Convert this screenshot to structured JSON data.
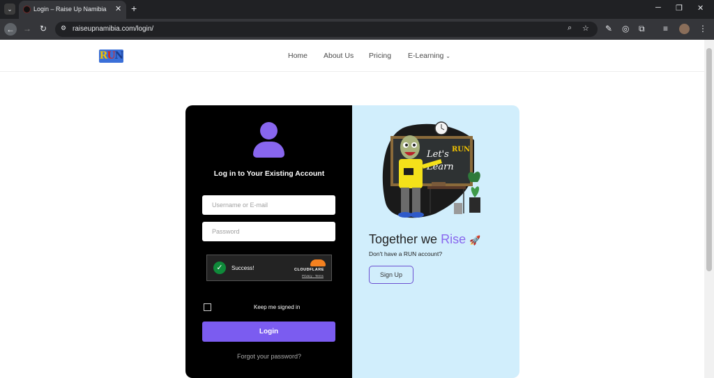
{
  "browser": {
    "tab_title": "Login – Raise Up Namibia",
    "url": "raiseupnamibia.com/login/"
  },
  "site": {
    "logo": {
      "r": "R",
      "u": "U",
      "n": "N"
    },
    "menu": [
      "Home",
      "About Us",
      "Pricing",
      "E-Learning"
    ]
  },
  "login": {
    "heading": "Log in to Your Existing Account",
    "username_placeholder": "Username or E-mail",
    "password_placeholder": "Password",
    "captcha_status": "Success!",
    "captcha_brand": "CLOUDFLARE",
    "captcha_privacy": "Privacy",
    "captcha_terms": "Terms",
    "keep_signed_in": "Keep me signed in",
    "login_button": "Login",
    "forgot_password": "Forgot your password?"
  },
  "promo": {
    "illustration_text_1": "Let's",
    "illustration_text_2": "Learn",
    "illustration_text_3": "RUN",
    "tagline_prefix": "Together we",
    "tagline_highlight": "Rise",
    "no_account": "Don't have a RUN account?",
    "signup_button": "Sign Up"
  },
  "colors": {
    "accent": "#7b5cf0",
    "promo_bg": "#d1eefc",
    "card_bg": "#000000"
  }
}
